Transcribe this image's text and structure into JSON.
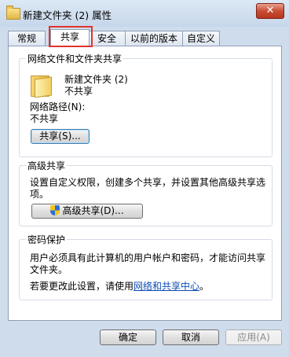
{
  "window": {
    "title": "新建文件夹 (2) 属性",
    "close_label": "✕"
  },
  "tabs": [
    {
      "label": "常规"
    },
    {
      "label": "共享"
    },
    {
      "label": "安全"
    },
    {
      "label": "以前的版本"
    },
    {
      "label": "自定义"
    }
  ],
  "network_share": {
    "title": "网络文件和文件夹共享",
    "folder_name": "新建文件夹 (2)",
    "folder_status": "不共享",
    "path_label": "网络路径(N):",
    "path_value": "不共享",
    "share_button": "共享(S)..."
  },
  "advanced_share": {
    "title": "高级共享",
    "description_line1": "设置自定义权限，创建多个共享，并设置其他高级共享选",
    "description_line2": "项。",
    "button": "高级共享(D)..."
  },
  "password": {
    "title": "密码保护",
    "line1": "用户必须具有此计算机的用户帐户和密码，才能访问共享",
    "line2": "文件夹。",
    "change_prefix": "若要更改此设置，请使用",
    "link": "网络和共享中心",
    "change_suffix": "。"
  },
  "footer": {
    "ok": "确定",
    "cancel": "取消",
    "apply": "应用(A)"
  }
}
